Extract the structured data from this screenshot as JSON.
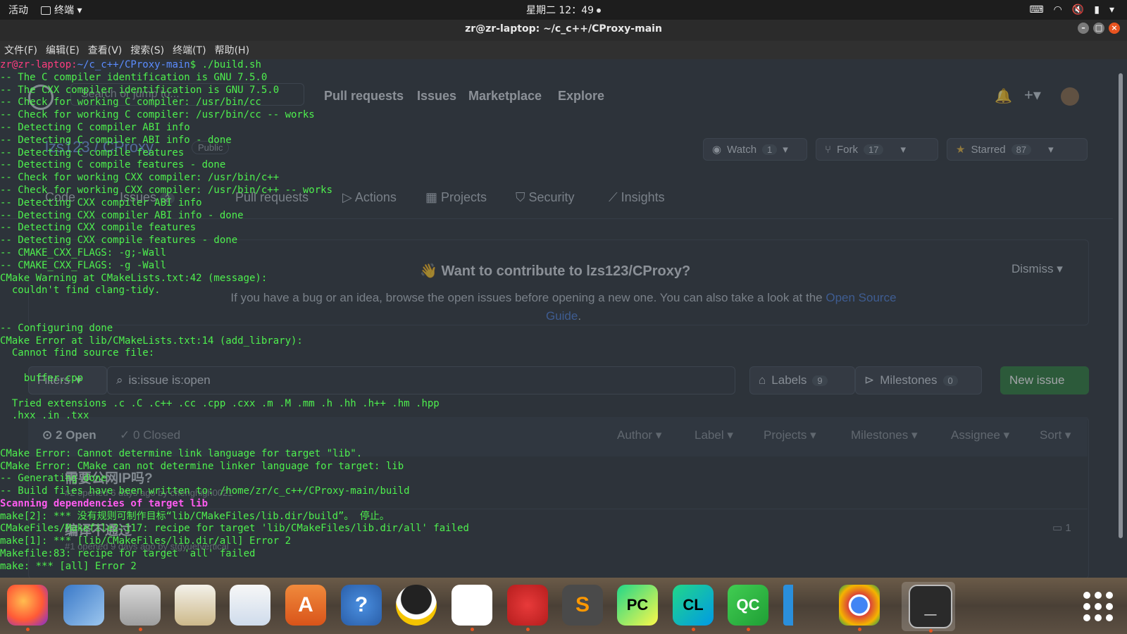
{
  "system_bar": {
    "activities": "活动",
    "app_name": "终端",
    "clock": "星期二 12：49"
  },
  "window": {
    "title": "zr@zr-laptop: ~/c_c++/CProxy-main"
  },
  "menu": [
    "文件(F)",
    "编辑(E)",
    "查看(V)",
    "搜索(S)",
    "终端(T)",
    "帮助(H)"
  ],
  "terminal": {
    "prompt_line": "zr@zr-laptop:~/c_c++/CProxy-main$ ./build.sh",
    "lines": [
      "-- The C compiler identification is GNU 7.5.0",
      "-- The CXX compiler identification is GNU 7.5.0",
      "-- Check for working C compiler: /usr/bin/cc",
      "-- Check for working C compiler: /usr/bin/cc -- works",
      "-- Detecting C compiler ABI info",
      "-- Detecting C compiler ABI info - done",
      "-- Detecting C compile features",
      "-- Detecting C compile features - done",
      "-- Check for working CXX compiler: /usr/bin/c++",
      "-- Check for working CXX compiler: /usr/bin/c++ -- works",
      "-- Detecting CXX compiler ABI info",
      "-- Detecting CXX compiler ABI info - done",
      "-- Detecting CXX compile features",
      "-- Detecting CXX compile features - done",
      "-- CMAKE_CXX_FLAGS: -g;-Wall",
      "-- CMAKE_CXX_FLAGS: -g -Wall",
      "CMake Warning at CMakeLists.txt:42 (message):",
      "  couldn't find clang-tidy.",
      "",
      "",
      "-- Configuring done",
      "CMake Error at lib/CMakeLists.txt:14 (add_library):",
      "  Cannot find source file:",
      "",
      "    buffer.cpp",
      "",
      "  Tried extensions .c .C .c++ .cc .cpp .cxx .m .M .mm .h .hh .h++ .hm .hpp",
      "  .hxx .in .txx",
      "",
      "",
      "CMake Error: Cannot determine link language for target \"lib\".",
      "CMake Error: CMake can not determine linker language for target: lib",
      "-- Generating done",
      "-- Build files have been written to: /home/zr/c_c++/CProxy-main/build"
    ],
    "scanning_line": "Scanning dependencies of target lib",
    "tail_lines": [
      "make[2]: *** 没有规则可制作目标“lib/CMakeFiles/lib.dir/build”。 停止。",
      "CMakeFiles/Makefile2:117: recipe for target 'lib/CMakeFiles/lib.dir/all' failed",
      "make[1]: *** [lib/CMakeFiles/lib.dir/all] Error 2",
      "Makefile:83: recipe for target 'all' failed",
      "make: *** [all] Error 2"
    ],
    "colors": {
      "prompt_user": "#ff3d7f",
      "prompt_path": "#5b8cff",
      "output": "#4ef04e",
      "scanning": "#ff5cf0"
    }
  },
  "background_page": {
    "search_placeholder": "Search or jump to...",
    "nav": [
      "Pull requests",
      "Issues",
      "Marketplace",
      "Explore"
    ],
    "repo": {
      "name": "lzs123 / CProxy",
      "visibility": "Public"
    },
    "watch": {
      "label": "Watch",
      "count": "1"
    },
    "fork": {
      "label": "Fork",
      "count": "17"
    },
    "starred": {
      "label": "Starred",
      "count": "87"
    },
    "tabs": [
      "Code",
      "Issues",
      "Pull requests",
      "Actions",
      "Projects",
      "Security",
      "Insights"
    ],
    "issues_tab_count": "2",
    "contribute": {
      "heading": "Want to contribute to lzs123/CProxy?",
      "body": "If you have a bug or an idea, browse the open issues before opening a new one. You can also take a look at the",
      "link": "Open Source Guide",
      "dismiss": "Dismiss"
    },
    "filters": "Filters",
    "search_value": "is:issue is:open",
    "labels": {
      "label": "Labels",
      "count": "9"
    },
    "milestones": {
      "label": "Milestones",
      "count": "0"
    },
    "new_issue": "New issue",
    "open_count": "2 Open",
    "closed_count": "0 Closed",
    "column_filters": [
      "Author",
      "Label",
      "Projects",
      "Milestones",
      "Assignee",
      "Sort"
    ],
    "issues": [
      {
        "title": "需要公网IP吗?",
        "meta": "#2 opened 6 days ago by chenghigh0021"
      },
      {
        "title": "编译不通过",
        "meta": "#1 opened 9 days ago by stgyuetvertical",
        "comments": "1"
      }
    ]
  },
  "dock": {
    "apps": [
      {
        "name": "firefox-icon",
        "label": ""
      },
      {
        "name": "thunderbird-icon",
        "label": ""
      },
      {
        "name": "files-icon",
        "label": ""
      },
      {
        "name": "rhythmbox-icon",
        "label": ""
      },
      {
        "name": "libreoffice-writer-icon",
        "label": ""
      },
      {
        "name": "software-center-icon",
        "label": "A"
      },
      {
        "name": "help-icon",
        "label": "?"
      },
      {
        "name": "qq-icon",
        "label": ""
      },
      {
        "name": "baidu-netdisk-icon",
        "label": ""
      },
      {
        "name": "netease-music-icon",
        "label": ""
      },
      {
        "name": "sublime-text-icon",
        "label": "S"
      },
      {
        "name": "pycharm-icon",
        "label": "PC"
      },
      {
        "name": "clion-icon",
        "label": "CL"
      },
      {
        "name": "qq-cloud-icon",
        "label": "QC"
      },
      {
        "name": "vscode-icon",
        "label": ""
      },
      {
        "name": "chrome-icon",
        "label": ""
      },
      {
        "name": "terminal-icon",
        "label": "_"
      }
    ]
  }
}
